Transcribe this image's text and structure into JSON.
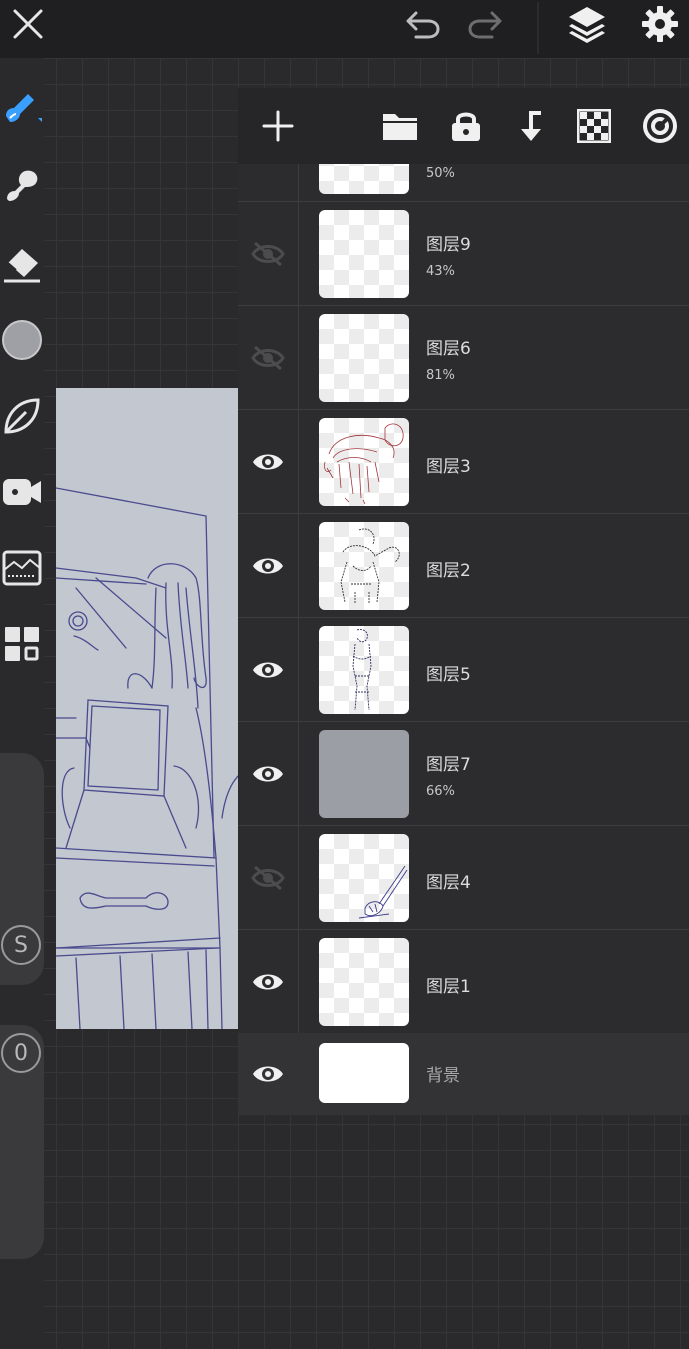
{
  "topbar": {
    "close_icon": "close-icon",
    "undo_icon": "undo-icon",
    "redo_icon": "redo-icon",
    "layers_icon": "layers-icon",
    "settings_icon": "gear-icon"
  },
  "toolbar": {
    "tools": [
      "brush-icon",
      "smudge-icon",
      "eraser-icon",
      "color-icon",
      "leaf-icon",
      "video-icon",
      "reference-icon",
      "grid-icon"
    ],
    "size_slider_label": "S",
    "opacity_slider_label": "0",
    "accent_color": "#3aa0ff"
  },
  "panel": {
    "header_actions": [
      "add-layer",
      "folder",
      "lock",
      "merge-down",
      "transparency",
      "clipping"
    ],
    "partial_layer": {
      "opacity": "50%"
    },
    "layers": [
      {
        "name": "图层9",
        "opacity": "43%",
        "visible": false,
        "thumb": "empty"
      },
      {
        "name": "图层6",
        "opacity": "81%",
        "visible": false,
        "thumb": "empty"
      },
      {
        "name": "图层3",
        "opacity": "",
        "visible": true,
        "thumb": "red-sketch"
      },
      {
        "name": "图层2",
        "opacity": "",
        "visible": true,
        "thumb": "outline-sketch"
      },
      {
        "name": "图层5",
        "opacity": "",
        "visible": true,
        "thumb": "figure-sketch"
      },
      {
        "name": "图层7",
        "opacity": "66%",
        "visible": true,
        "thumb": "gray-fill"
      },
      {
        "name": "图层4",
        "opacity": "",
        "visible": false,
        "thumb": "blue-sketch"
      },
      {
        "name": "图层1",
        "opacity": "",
        "visible": true,
        "thumb": "empty"
      }
    ],
    "background_layer": {
      "name": "背景",
      "visible": true
    }
  }
}
